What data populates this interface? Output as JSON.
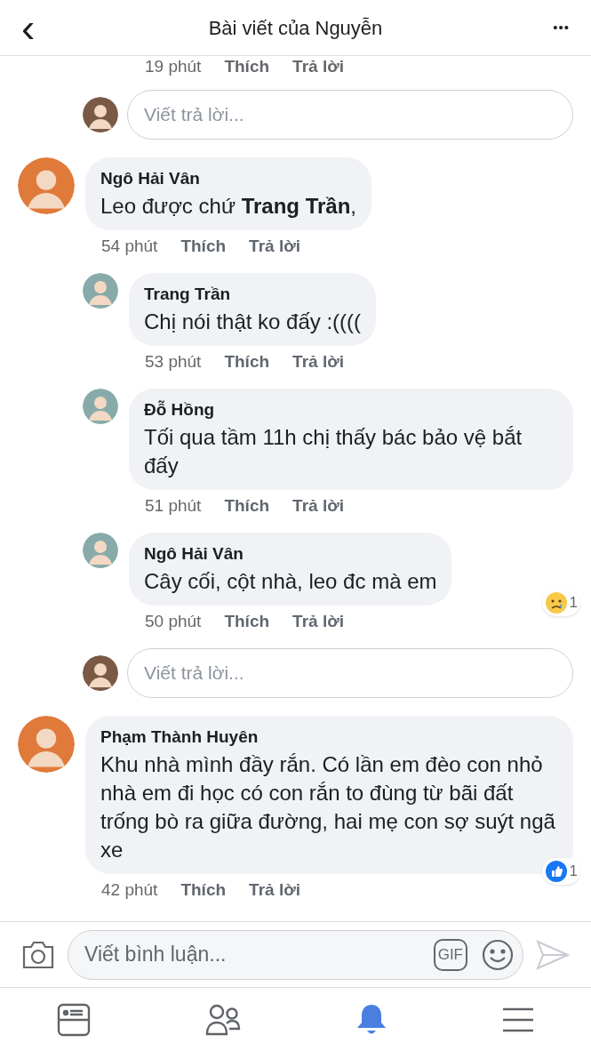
{
  "header": {
    "back": "‹",
    "title": "Bài viết của Nguyễn",
    "more": "•••"
  },
  "top_actions": {
    "time": "19 phút",
    "like": "Thích",
    "reply": "Trả lời"
  },
  "top_reply_box": {
    "placeholder": "Viết trả lời..."
  },
  "comments": [
    {
      "author": "Ngô Hải Vân",
      "text": "Leo được chứ **Trang Trần**,",
      "time": "54 phút",
      "like": "Thích",
      "reply": "Trả lời",
      "children": [
        {
          "author": "Trang Trần",
          "text": "Chị nói thật ko đấy :((((",
          "time": "53 phút",
          "like": "Thích",
          "reply": "Trả lời"
        },
        {
          "author": "Đỗ Hồng",
          "text": "Tối qua tầm 11h chị thấy bác bảo vệ bắt đấy",
          "time": "51 phút",
          "like": "Thích",
          "reply": "Trả lời"
        },
        {
          "author": "Ngô Hải Vân",
          "text": "Cây cối, cột nhà, leo đc mà em",
          "time": "50 phút",
          "like": "Thích",
          "reply": "Trả lời",
          "reaction": {
            "kind": "sad",
            "count": "1"
          }
        }
      ],
      "reply_box": {
        "placeholder": "Viết trả lời..."
      }
    },
    {
      "author": "Phạm Thành Huyên",
      "text": "Khu nhà mình đầy rắn. Có lần em đèo con nhỏ nhà em đi học có con rắn to đùng từ bãi đất trống bò ra giữa đường, hai mẹ con sợ suýt ngã xe",
      "time": "42 phút",
      "like": "Thích",
      "reply": "Trả lời",
      "reaction": {
        "kind": "like",
        "count": "1"
      }
    }
  ],
  "composer": {
    "placeholder": "Viết bình luận...",
    "gif": "GIF"
  },
  "tabs": [
    {
      "kind": "feed",
      "selected": false
    },
    {
      "kind": "friends",
      "selected": false
    },
    {
      "kind": "notifications",
      "selected": true
    },
    {
      "kind": "menu",
      "selected": false
    }
  ]
}
